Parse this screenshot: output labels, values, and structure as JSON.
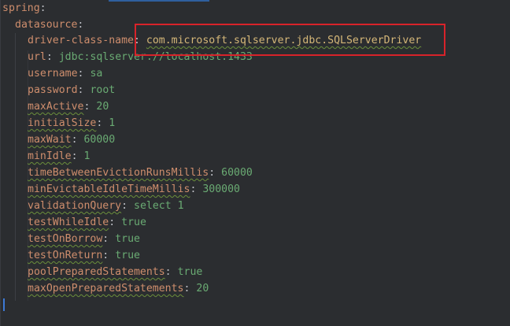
{
  "editor": {
    "lines": [
      {
        "key": "spring",
        "colon": ":",
        "value": ""
      },
      {
        "key": "datasource",
        "colon": ":",
        "value": ""
      },
      {
        "key": "driver-class-name",
        "colon": ":",
        "value": "com.microsoft.sqlserver.jdbc.SQLServerDriver"
      },
      {
        "key": "url",
        "colon": ":",
        "value": "jdbc:sqlserver://localhost:1433"
      },
      {
        "key": "username",
        "colon": ":",
        "value": "sa"
      },
      {
        "key": "password",
        "colon": ":",
        "value": "root"
      },
      {
        "key": "maxActive",
        "colon": ":",
        "value": "20"
      },
      {
        "key": "initialSize",
        "colon": ":",
        "value": "1"
      },
      {
        "key": "maxWait",
        "colon": ":",
        "value": "60000"
      },
      {
        "key": "minIdle",
        "colon": ":",
        "value": "1"
      },
      {
        "key": "timeBetweenEvictionRunsMillis",
        "colon": ":",
        "value": "60000"
      },
      {
        "key": "minEvictableIdleTimeMillis",
        "colon": ":",
        "value": "300000"
      },
      {
        "key": "validationQuery",
        "colon": ":",
        "value": "select 1"
      },
      {
        "key": "testWhileIdle",
        "colon": ":",
        "value": "true"
      },
      {
        "key": "testOnBorrow",
        "colon": ":",
        "value": "true"
      },
      {
        "key": "testOnReturn",
        "colon": ":",
        "value": "true"
      },
      {
        "key": "poolPreparedStatements",
        "colon": ":",
        "value": "true"
      },
      {
        "key": "maxOpenPreparedStatements",
        "colon": ":",
        "value": "20"
      }
    ]
  },
  "colors": {
    "background": "#2b2d30",
    "key": "#cf8e6d",
    "value": "#6aab73",
    "highlight_border": "#d8232a",
    "caret": "#3d7ad6"
  }
}
